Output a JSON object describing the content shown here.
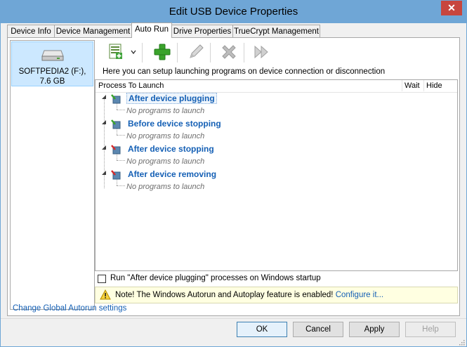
{
  "window": {
    "title": "Edit USB Device Properties",
    "close_glyph": "✕"
  },
  "tabs": [
    {
      "label": "Device Info"
    },
    {
      "label": "Device Management"
    },
    {
      "label": "Auto Run"
    },
    {
      "label": "Drive Properties"
    },
    {
      "label": "TrueCrypt Management"
    }
  ],
  "device": {
    "line1": "SOFTPEDIA2 (F:),",
    "line2": "7.6 GB",
    "icon": "usb-drive-icon"
  },
  "toolbar": {
    "buttons": [
      {
        "icon": "new-program-icon",
        "action": "add-menu"
      },
      {
        "icon": "plus-icon",
        "action": "add"
      },
      {
        "icon": "pencil-icon",
        "action": "edit"
      },
      {
        "icon": "x-delete-icon",
        "action": "delete"
      },
      {
        "icon": "run-icon",
        "action": "run"
      }
    ]
  },
  "hint": "Here you can setup launching programs on device connection or disconnection",
  "grid": {
    "columns": [
      "Process To Launch",
      "Wait",
      "Hide"
    ],
    "events": [
      {
        "label": "After device plugging",
        "child": "No programs to launch"
      },
      {
        "label": "Before device stopping",
        "child": "No programs to launch"
      },
      {
        "label": "After device stopping",
        "child": "No programs to launch"
      },
      {
        "label": "After device removing",
        "child": "No programs to launch"
      }
    ]
  },
  "startup_checkbox": {
    "label": "Run \"After device plugging\" processes on Windows startup",
    "checked": false
  },
  "notice": {
    "text": "Note! The Windows Autorun and Autoplay feature is enabled!",
    "link": "Configure it..."
  },
  "footer_link": "Change Global Autorun settings",
  "buttons": {
    "ok": "OK",
    "cancel": "Cancel",
    "apply": "Apply",
    "help": "Help"
  },
  "colors": {
    "titlebar": "#6fa6d6",
    "close": "#c7463e",
    "link": "#1560b5",
    "selection": "#cce8ff",
    "notice_bg": "#ffffe1"
  }
}
